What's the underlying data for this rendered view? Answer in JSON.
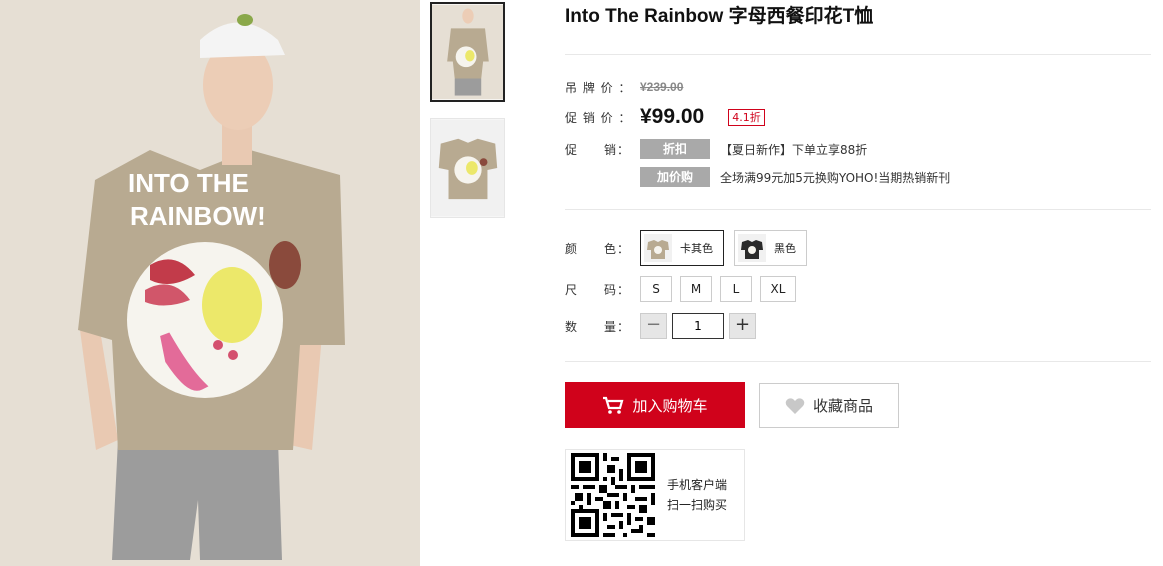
{
  "product": {
    "title": "Into The Rainbow 字母西餐印花T恤",
    "tag_price_label": "吊 牌 价 ：",
    "tag_price": "¥239.00",
    "sale_price_label": "促 销 价 ：",
    "sale_price": "¥99.00",
    "discount": "4.1折",
    "promo_label": "促　　销：",
    "promotions": [
      {
        "tag": "折扣",
        "text": "【夏日新作】下单立享88折"
      },
      {
        "tag": "加价购",
        "text": "全场满99元加5元换购YOHO!当期热销新刊"
      }
    ],
    "color_label": "颜　　色：",
    "colors": [
      {
        "label": "卡其色",
        "selected": true,
        "swatch": "#b7a98f"
      },
      {
        "label": "黑色",
        "selected": false,
        "swatch": "#2a2a2a"
      }
    ],
    "size_label": "尺　　码：",
    "sizes": [
      "S",
      "M",
      "L",
      "XL"
    ],
    "qty_label": "数　　量：",
    "quantity": "1",
    "qty_minus": "−",
    "qty_plus": "+",
    "add_to_cart": "加入购物车",
    "favorite": "收藏商品",
    "qr_line1": "手机客户端",
    "qr_line2": "扫一扫购买",
    "shirt_print_line1": "INTO THE",
    "shirt_print_line2": "RAINBOW!"
  },
  "colors": {
    "accent": "#d0021b",
    "tag_gray": "#a9a9a9",
    "shirt": "#b7a98f",
    "background": "#e4ddd2"
  },
  "icons": [
    "cart-icon",
    "heart-icon",
    "qr-code-icon"
  ]
}
